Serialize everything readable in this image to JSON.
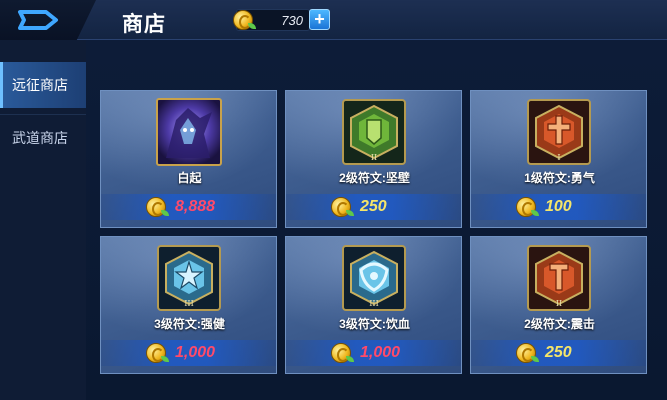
{
  "header": {
    "title": "商店",
    "coins": "730",
    "add_label": "+"
  },
  "sidebar": {
    "items": [
      {
        "label": "远征商店",
        "active": true
      },
      {
        "label": "武道商店",
        "active": false
      }
    ]
  },
  "shop": {
    "items": [
      {
        "name": "白起",
        "price": "8,888",
        "kind": "hero"
      },
      {
        "name": "2级符文:坚壁",
        "price": "250",
        "kind": "rune-green",
        "level": "II"
      },
      {
        "name": "1级符文:勇气",
        "price": "100",
        "kind": "rune-red",
        "level": "I"
      },
      {
        "name": "3级符文:强健",
        "price": "1,000",
        "kind": "rune-blue",
        "level": "III"
      },
      {
        "name": "3级符文:饮血",
        "price": "1,000",
        "kind": "rune-blue",
        "level": "III"
      },
      {
        "name": "2级符文:震击",
        "price": "250",
        "kind": "rune-red",
        "level": "II"
      }
    ]
  },
  "colors": {
    "hero_price": "#ff4a6a",
    "rune_price": "#f5e56a",
    "accent": "#4db8ff"
  }
}
